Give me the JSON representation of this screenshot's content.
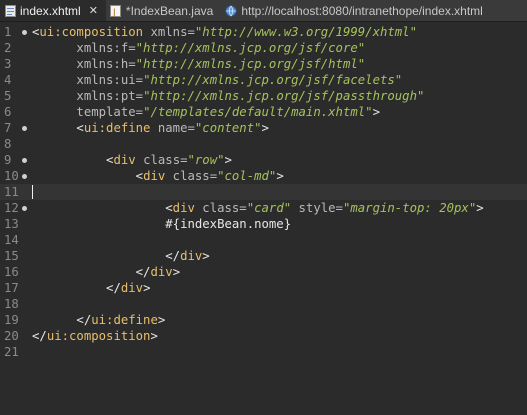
{
  "tabs": [
    {
      "label": "index.xhtml",
      "close": "✕",
      "icon": "xhtml-file-icon"
    },
    {
      "label": "*IndexBean.java",
      "icon": "java-file-icon"
    },
    {
      "label": "http://localhost:8080/intranethope/index.xhtml",
      "icon": "globe-icon"
    }
  ],
  "current_line": 11,
  "lines": [
    {
      "n": "1",
      "fold": true,
      "tokens": [
        [
          "<",
          "pun"
        ],
        [
          "ui:composition",
          "tag"
        ],
        [
          " xmlns=",
          "attr"
        ],
        [
          "\"http://www.w3.org/1999/xhtml\"",
          "str"
        ]
      ]
    },
    {
      "n": "2",
      "tokens": [
        [
          "      xmlns:f=",
          "attr"
        ],
        [
          "\"http://xmlns.jcp.org/jsf/core\"",
          "str"
        ]
      ]
    },
    {
      "n": "3",
      "tokens": [
        [
          "      xmlns:h=",
          "attr"
        ],
        [
          "\"http://xmlns.jcp.org/jsf/html\"",
          "str"
        ]
      ]
    },
    {
      "n": "4",
      "tokens": [
        [
          "      xmlns:ui=",
          "attr"
        ],
        [
          "\"http://xmlns.jcp.org/jsf/facelets\"",
          "str"
        ]
      ]
    },
    {
      "n": "5",
      "tokens": [
        [
          "      xmlns:pt=",
          "attr"
        ],
        [
          "\"http://xmlns.jcp.org/jsf/passthrough\"",
          "str"
        ]
      ]
    },
    {
      "n": "6",
      "tokens": [
        [
          "      template=",
          "attr"
        ],
        [
          "\"/templates/default/main.xhtml\"",
          "str"
        ],
        [
          ">",
          "pun"
        ]
      ]
    },
    {
      "n": "7",
      "fold": true,
      "tokens": [
        [
          "      ",
          "txt"
        ],
        [
          "<",
          "pun"
        ],
        [
          "ui:define",
          "tag"
        ],
        [
          " name=",
          "attr"
        ],
        [
          "\"content\"",
          "str"
        ],
        [
          ">",
          "pun"
        ]
      ]
    },
    {
      "n": "8",
      "tokens": []
    },
    {
      "n": "9",
      "fold": true,
      "tokens": [
        [
          "          ",
          "txt"
        ],
        [
          "<",
          "pun"
        ],
        [
          "div",
          "tag"
        ],
        [
          " class=",
          "attr"
        ],
        [
          "\"row\"",
          "str"
        ],
        [
          ">",
          "pun"
        ]
      ]
    },
    {
      "n": "10",
      "fold": true,
      "tokens": [
        [
          "              ",
          "txt"
        ],
        [
          "<",
          "pun"
        ],
        [
          "div",
          "tag"
        ],
        [
          " class=",
          "attr"
        ],
        [
          "\"col-md\"",
          "str"
        ],
        [
          ">",
          "pun"
        ]
      ]
    },
    {
      "n": "11",
      "tokens": []
    },
    {
      "n": "12",
      "fold": true,
      "tokens": [
        [
          "                  ",
          "txt"
        ],
        [
          "<",
          "pun"
        ],
        [
          "div",
          "tag"
        ],
        [
          " class=",
          "attr"
        ],
        [
          "\"card\"",
          "str"
        ],
        [
          " style=",
          "attr"
        ],
        [
          "\"margin-top: 20px\"",
          "str"
        ],
        [
          ">",
          "pun"
        ]
      ]
    },
    {
      "n": "13",
      "tokens": [
        [
          "                  #{indexBean.nome}",
          "txt"
        ]
      ]
    },
    {
      "n": "14",
      "tokens": []
    },
    {
      "n": "15",
      "tokens": [
        [
          "                  ",
          "txt"
        ],
        [
          "</",
          "pun"
        ],
        [
          "div",
          "tag"
        ],
        [
          ">",
          "pun"
        ]
      ]
    },
    {
      "n": "16",
      "tokens": [
        [
          "              ",
          "txt"
        ],
        [
          "</",
          "pun"
        ],
        [
          "div",
          "tag"
        ],
        [
          ">",
          "pun"
        ]
      ]
    },
    {
      "n": "17",
      "tokens": [
        [
          "          ",
          "txt"
        ],
        [
          "</",
          "pun"
        ],
        [
          "div",
          "tag"
        ],
        [
          ">",
          "pun"
        ]
      ]
    },
    {
      "n": "18",
      "tokens": []
    },
    {
      "n": "19",
      "tokens": [
        [
          "      ",
          "txt"
        ],
        [
          "</",
          "pun"
        ],
        [
          "ui:define",
          "tag"
        ],
        [
          ">",
          "pun"
        ]
      ]
    },
    {
      "n": "20",
      "tokens": [
        [
          "</",
          "pun"
        ],
        [
          "ui:composition",
          "tag"
        ],
        [
          ">",
          "pun"
        ]
      ]
    },
    {
      "n": "21",
      "tokens": []
    }
  ]
}
